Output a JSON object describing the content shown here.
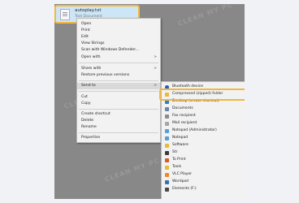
{
  "file": {
    "name": "autoplay.txt",
    "type": "Text Document"
  },
  "context_menu": {
    "items": [
      {
        "label": "Open",
        "arrow": ""
      },
      {
        "label": "Print",
        "arrow": ""
      },
      {
        "label": "Edit",
        "arrow": ""
      },
      {
        "label": "View Strings",
        "arrow": ""
      },
      {
        "label": "Scan with Windows Defender...",
        "arrow": ""
      },
      {
        "label": "Open with",
        "arrow": ">"
      },
      {
        "label": "Share with",
        "arrow": ">"
      },
      {
        "label": "Restore previous versions",
        "arrow": ""
      },
      {
        "label": "Send to",
        "arrow": ">"
      },
      {
        "label": "Cut",
        "arrow": ""
      },
      {
        "label": "Copy",
        "arrow": ""
      },
      {
        "label": "Create shortcut",
        "arrow": ""
      },
      {
        "label": "Delete",
        "arrow": ""
      },
      {
        "label": "Rename",
        "arrow": ""
      },
      {
        "label": "Properties",
        "arrow": ""
      }
    ]
  },
  "send_to_menu": {
    "items": [
      {
        "label": "Bluetooth device",
        "icon": "bluetooth-icon",
        "color": "#1f5fbf"
      },
      {
        "label": "Compressed (zipped) folder",
        "icon": "zip-folder-icon",
        "color": "#e8b93a"
      },
      {
        "label": "Desktop (create shortcut)",
        "icon": "desktop-icon",
        "color": "#2d7fd3"
      },
      {
        "label": "Documents",
        "icon": "documents-icon",
        "color": "#6a86a8"
      },
      {
        "label": "Fax recipient",
        "icon": "fax-icon",
        "color": "#8c8c8c"
      },
      {
        "label": "Mail recipient",
        "icon": "mail-icon",
        "color": "#a6a6a6"
      },
      {
        "label": "Notepad (Administrator)",
        "icon": "notepad-icon",
        "color": "#5a9fd4"
      },
      {
        "label": "Notepad",
        "icon": "notepad-icon",
        "color": "#5a9fd4"
      },
      {
        "label": "Software",
        "icon": "folder-icon",
        "color": "#e8b93a"
      },
      {
        "label": "Str",
        "icon": "app-icon",
        "color": "#3d3d3d"
      },
      {
        "label": "To Print",
        "icon": "printer-icon",
        "color": "#d85a2a"
      },
      {
        "label": "Tools",
        "icon": "folder-icon",
        "color": "#e8b93a"
      },
      {
        "label": "VLC Player",
        "icon": "vlc-icon",
        "color": "#f08a1c"
      },
      {
        "label": "Wordpad",
        "icon": "wordpad-icon",
        "color": "#3a6fb0"
      },
      {
        "label": "Elements (F:)",
        "icon": "drive-icon",
        "color": "#4a4a4a"
      }
    ]
  },
  "watermark": "CLEAN MY PC",
  "accent_color": "#f4b63f"
}
